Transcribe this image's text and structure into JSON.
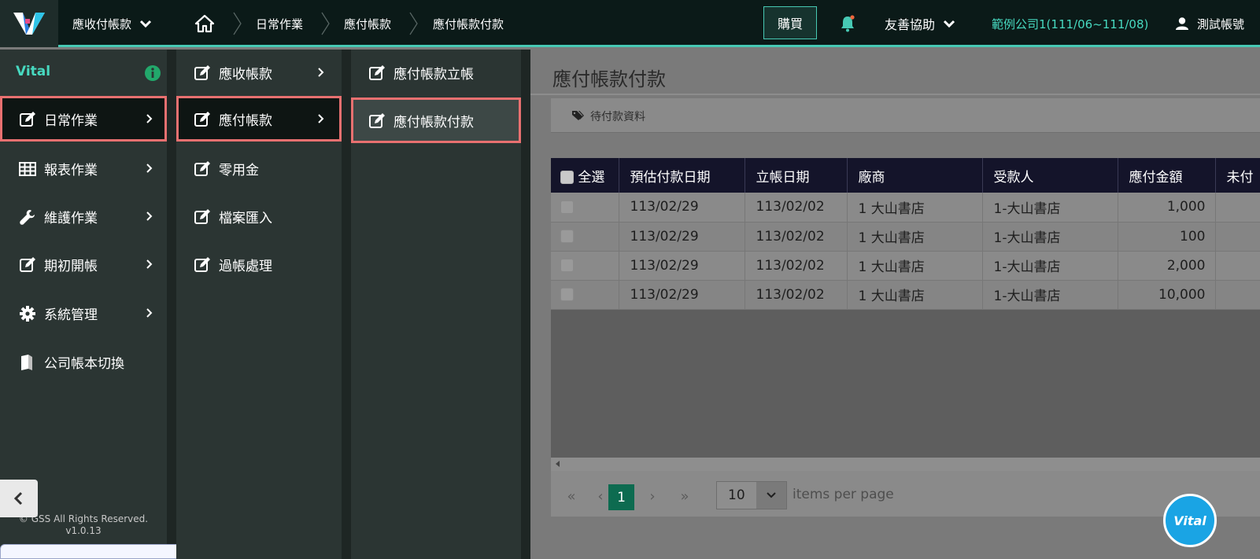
{
  "topbar": {
    "app_menu_label": "應收付帳款",
    "breadcrumb": [
      "日常作業",
      "應付帳款",
      "應付帳款付款"
    ],
    "buy_label": "購買",
    "help_label": "友善協助",
    "company_label": "範例公司1(111/06~111/08)",
    "account_label": "測試帳號"
  },
  "sidebar": {
    "brand": "Vital",
    "items": [
      {
        "label": "日常作業",
        "icon": "edit-icon"
      },
      {
        "label": "報表作業",
        "icon": "table-icon"
      },
      {
        "label": "維護作業",
        "icon": "wrench-icon"
      },
      {
        "label": "期初開帳",
        "icon": "edit-icon"
      },
      {
        "label": "系統管理",
        "icon": "gear-icon"
      },
      {
        "label": "公司帳本切換",
        "icon": "book-icon"
      }
    ],
    "footer_copyright": "© GSS All Rights Reserved.",
    "footer_version": "v1.0.13"
  },
  "submenu": {
    "items": [
      "應收帳款",
      "應付帳款",
      "零用金",
      "檔案匯入",
      "過帳處理"
    ]
  },
  "leafmenu": {
    "items": [
      "應付帳款立帳",
      "應付帳款付款"
    ]
  },
  "main": {
    "title": "應付帳款付款",
    "section_label": "待付款資料"
  },
  "grid": {
    "select_all_label": "全選",
    "columns": [
      "預估付款日期",
      "立帳日期",
      "廠商",
      "受款人",
      "應付金額",
      "未付"
    ],
    "rows": [
      {
        "due_date": "113/02/29",
        "post_date": "113/02/02",
        "vendor": "1 大山書店",
        "payee": "1-大山書店",
        "amount": "1,000"
      },
      {
        "due_date": "113/02/29",
        "post_date": "113/02/02",
        "vendor": "1 大山書店",
        "payee": "1-大山書店",
        "amount": "100"
      },
      {
        "due_date": "113/02/29",
        "post_date": "113/02/02",
        "vendor": "1 大山書店",
        "payee": "1-大山書店",
        "amount": "2,000"
      },
      {
        "due_date": "113/02/29",
        "post_date": "113/02/02",
        "vendor": "1 大山書店",
        "payee": "1-大山書店",
        "amount": "10,000"
      }
    ]
  },
  "pager": {
    "first": "«",
    "prev": "‹",
    "current_page": "1",
    "next": "›",
    "last": "»",
    "page_size": "10",
    "page_size_label": "items per page"
  },
  "fab_label": "Vital",
  "colors": {
    "accent": "#47c9b4",
    "highlight_border": "#e87070",
    "pager_active": "#0d6b50",
    "fab": "#1aa4e4"
  }
}
